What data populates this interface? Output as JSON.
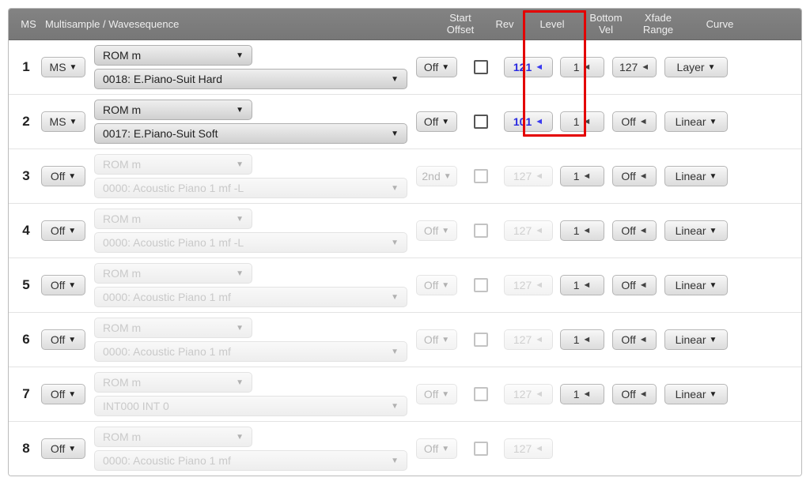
{
  "header": {
    "ms": "MS",
    "bank": "Multisample / Wavesequence",
    "offset_l1": "Start",
    "offset_l2": "Offset",
    "rev": "Rev",
    "level": "Level",
    "botvel_l1": "Bottom",
    "botvel_l2": "Vel",
    "xfade_l1": "Xfade",
    "xfade_l2": "Range",
    "curve": "Curve"
  },
  "rows": [
    {
      "idx": "1",
      "ms": "MS",
      "bank": "ROM m",
      "wave": "0018: E.Piano-Suit Hard",
      "offset": "Off",
      "level": "121",
      "botvel": "1",
      "xfade": "127",
      "curve": "Layer",
      "enabled": true
    },
    {
      "idx": "2",
      "ms": "MS",
      "bank": "ROM m",
      "wave": "0017: E.Piano-Suit Soft",
      "offset": "Off",
      "level": "101",
      "botvel": "1",
      "xfade": "Off",
      "curve": "Linear",
      "enabled": true
    },
    {
      "idx": "3",
      "ms": "Off",
      "bank": "ROM m",
      "wave": "0000: Acoustic Piano 1 mf -L",
      "offset": "2nd",
      "level": "127",
      "botvel": "1",
      "xfade": "Off",
      "curve": "Linear",
      "enabled": false
    },
    {
      "idx": "4",
      "ms": "Off",
      "bank": "ROM m",
      "wave": "0000: Acoustic Piano 1 mf -L",
      "offset": "Off",
      "level": "127",
      "botvel": "1",
      "xfade": "Off",
      "curve": "Linear",
      "enabled": false
    },
    {
      "idx": "5",
      "ms": "Off",
      "bank": "ROM m",
      "wave": "0000: Acoustic Piano 1 mf",
      "offset": "Off",
      "level": "127",
      "botvel": "1",
      "xfade": "Off",
      "curve": "Linear",
      "enabled": false
    },
    {
      "idx": "6",
      "ms": "Off",
      "bank": "ROM m",
      "wave": "0000: Acoustic Piano 1 mf",
      "offset": "Off",
      "level": "127",
      "botvel": "1",
      "xfade": "Off",
      "curve": "Linear",
      "enabled": false
    },
    {
      "idx": "7",
      "ms": "Off",
      "bank": "ROM m",
      "wave": "INT000 INT 0",
      "offset": "Off",
      "level": "127",
      "botvel": "1",
      "xfade": "Off",
      "curve": "Linear",
      "enabled": false
    },
    {
      "idx": "8",
      "ms": "Off",
      "bank": "ROM m",
      "wave": "0000: Acoustic Piano 1 mf",
      "offset": "Off",
      "level": "127",
      "botvel": "",
      "xfade": "",
      "curve": "",
      "enabled": false
    }
  ]
}
